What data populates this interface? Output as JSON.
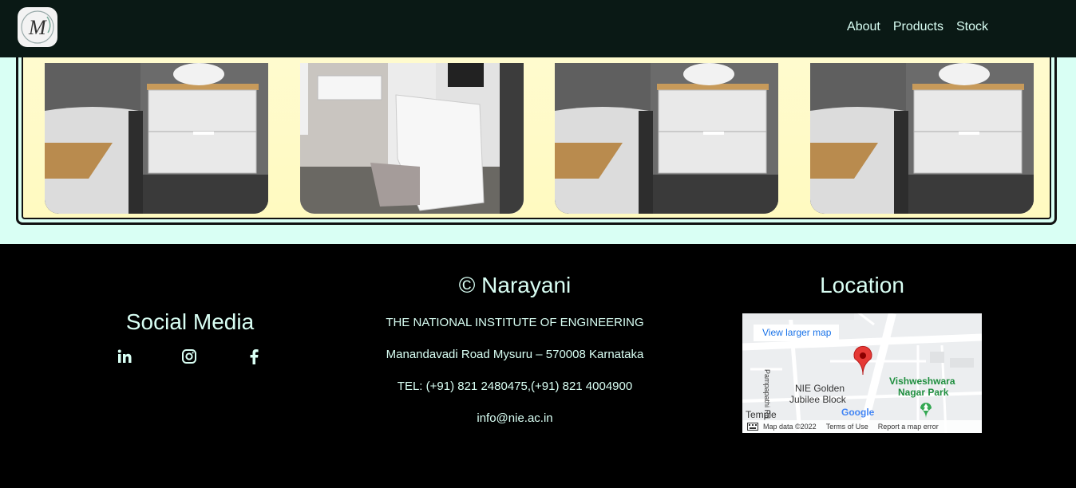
{
  "nav": {
    "logo_letter": "M",
    "links": [
      "About",
      "Products",
      "Stock"
    ]
  },
  "footer": {
    "social": {
      "title": "Social Media",
      "icons": [
        "linkedin-icon",
        "instagram-icon",
        "facebook-icon"
      ]
    },
    "copyright": {
      "title": "© Narayani",
      "institute": "THE NATIONAL INSTITUTE OF ENGINEERING",
      "address": "Manandavadi Road Mysuru – 570008 Karnataka",
      "phone": "TEL: (+91) 821 2480475,(+91) 821 4004900",
      "email": "info@nie.ac.in"
    },
    "location": {
      "title": "Location",
      "map": {
        "view_larger": "View larger map",
        "park_label_1": "Vishweshwara",
        "park_label_2": "Nagar Park",
        "block_label_1": "NIE Golden",
        "block_label_2": "Jubilee Block",
        "temple": "Temple",
        "road": "Pampapathi Rd",
        "map_data": "Map data ©2022",
        "terms": "Terms of Use",
        "report": "Report a map error",
        "google": "Google"
      }
    }
  },
  "colors": {
    "nav_bg": "#0a1915",
    "accent_text": "#d9fff4",
    "page_bg": "#d9fff4",
    "frame_bg": "#fffbd0",
    "footer_bg": "#000000"
  }
}
